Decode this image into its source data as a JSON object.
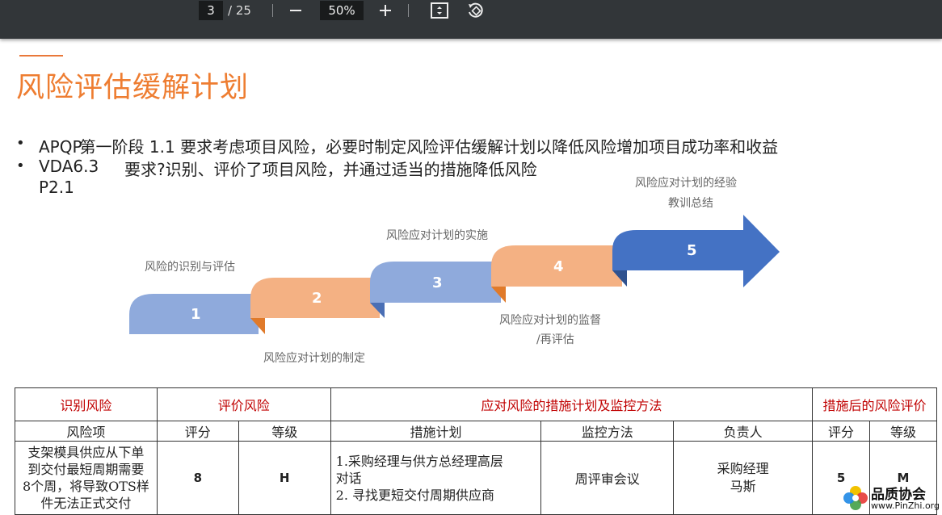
{
  "toolbar": {
    "page_current": "3",
    "page_total": "/ 25",
    "zoom": "50%",
    "zoom_out_icon": "minus-icon",
    "zoom_in_icon": "plus-icon",
    "fit_icon": "fit-page-icon",
    "rotate_icon": "rotate-icon"
  },
  "slide": {
    "title": "风险评估缓解计划",
    "bullets": [
      {
        "lead": "APQP",
        "text": "第一阶段 1.1 要求考虑项目风险，必要时制定风险评估缓解计划以降低风险增加项目成功率和收益"
      },
      {
        "lead": "VDA6.3",
        "lead2": "P2.1",
        "text": "要求?识别、评价了项目风险，并通过适当的措施降低风险"
      }
    ],
    "steps": [
      "1",
      "2",
      "3",
      "4",
      "5"
    ],
    "step_labels": {
      "s1": "风险的识别与评估",
      "s2": "风险应对计划的制定",
      "s3": "风险应对计划的实施",
      "s4_line1": "风险应对计划的监督",
      "s4_line2": "/再评估",
      "s5_line1": "风险应对计划的经验",
      "s5_line2": "教训总结"
    },
    "colors": {
      "step1": "#8faadc",
      "step2": "#f4b183",
      "step3": "#8faadc",
      "step4": "#f4b183",
      "step5": "#4472c4",
      "title": "#ee7d31",
      "header": "#c00000"
    }
  },
  "table": {
    "groups": [
      "识别风险",
      "评价风险",
      "应对风险的措施计划及监控方法",
      "措施后的风险评价"
    ],
    "columns": [
      "风险项",
      "评分",
      "等级",
      "措施计划",
      "监控方法",
      "负责人",
      "评分",
      "等级"
    ],
    "row": {
      "risk_item": [
        "支架模具供应从下单",
        "到交付最短周期需要",
        "8个周，将导致OTS样",
        "件无法正式交付"
      ],
      "score": "8",
      "level": "H",
      "plan": [
        "1.采购经理与供方总经理高层",
        "对话",
        "2. 寻找更短交付周期供应商"
      ],
      "monitor": "周评审会议",
      "owner": [
        "采购经理",
        "马斯"
      ],
      "score_after": "5",
      "level_after": "M"
    }
  },
  "watermark": {
    "name": "品质协会",
    "url": "www.PinZhi.org"
  }
}
